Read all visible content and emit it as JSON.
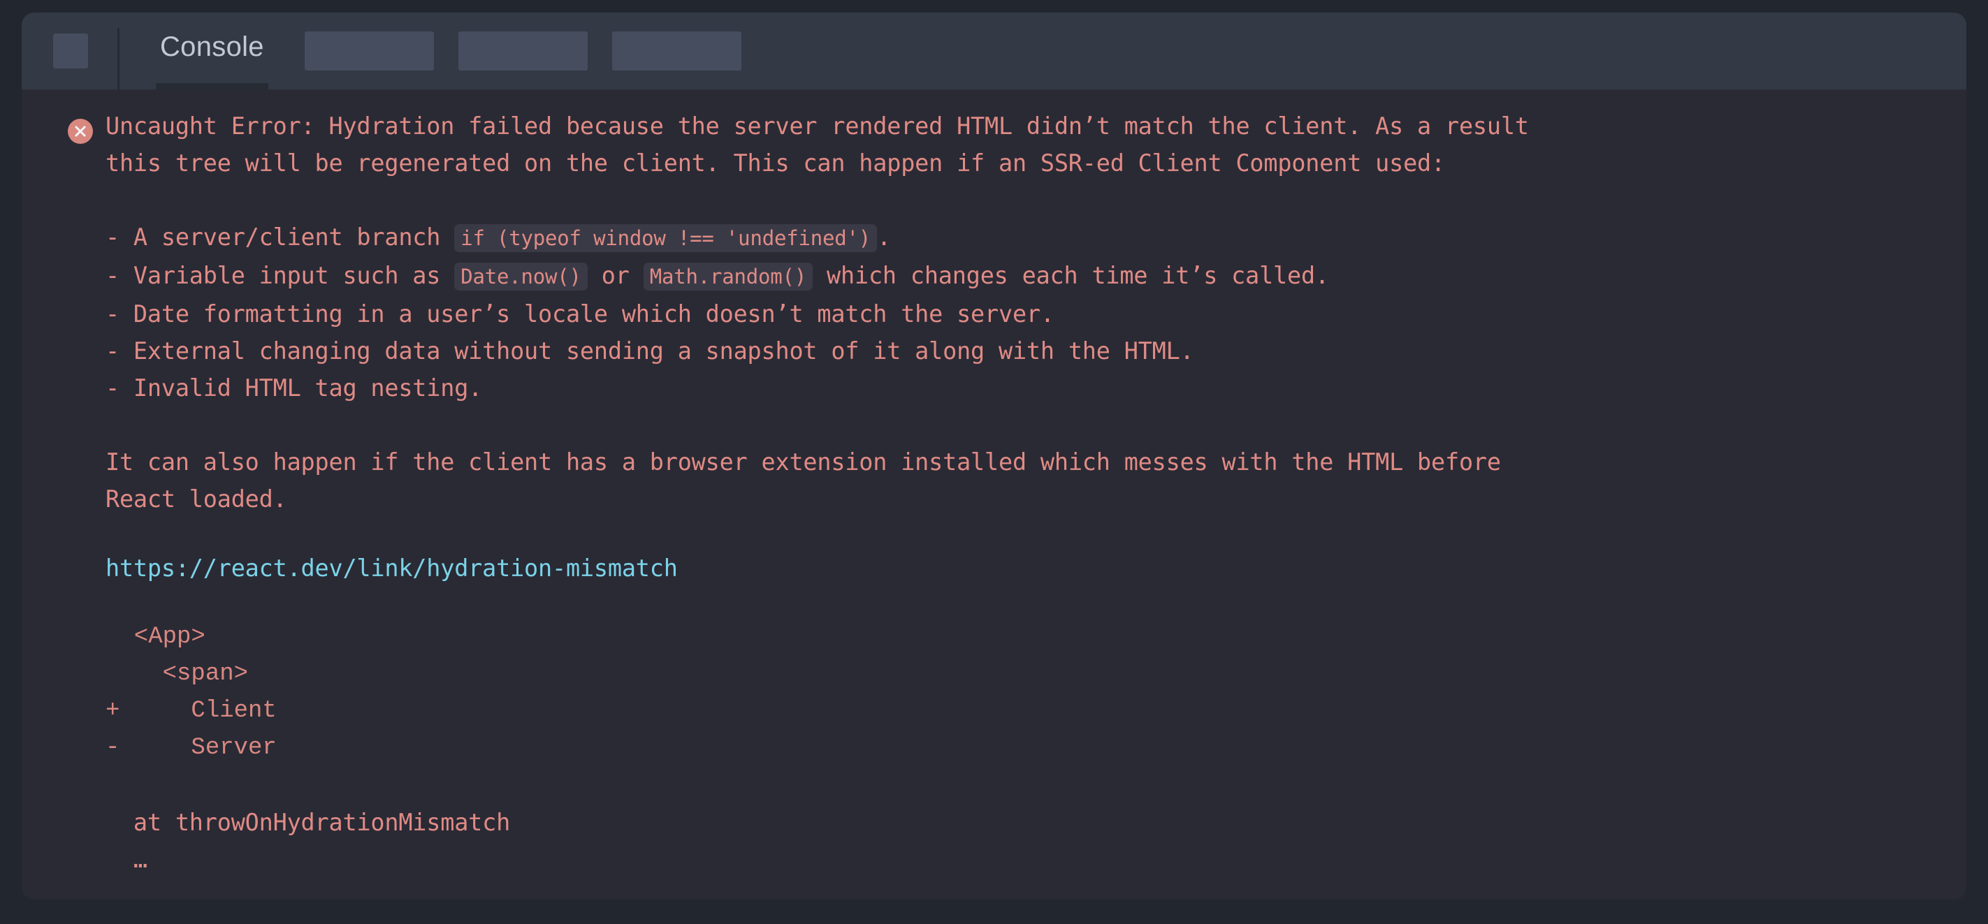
{
  "window": {
    "background_color": "#22262e",
    "panel_background": "#2a2a35",
    "header_background": "#333945"
  },
  "header": {
    "app_icon_name": "square-placeholder-icon",
    "tabs": [
      {
        "label": "Console",
        "active": true
      },
      {
        "label": "",
        "active": false
      },
      {
        "label": "",
        "active": false
      },
      {
        "label": "",
        "active": false
      }
    ],
    "placeholder_count": 3
  },
  "console": {
    "entry": {
      "level": "error",
      "icon": "error-circle-x-icon",
      "icon_color": "#d98880",
      "text_color": "#e08b85",
      "link_color": "#7bd3e8",
      "paragraph_1": "Uncaught Error: Hydration failed because the server rendered HTML didn’t match the client. As a result\nthis tree will be regenerated on the client. This can happen if an SSR-ed Client Component used:",
      "bullets": [
        {
          "prefix": "- A server/client branch ",
          "code": "if (typeof window !== 'undefined')",
          "suffix": "."
        },
        {
          "prefix": "- Variable input such as ",
          "code": "Date.now()",
          "middle": " or ",
          "code2": "Math.random()",
          "suffix": " which changes each time it’s called."
        },
        {
          "prefix": "- Date formatting in a user’s locale which doesn’t match the server.",
          "code": "",
          "suffix": ""
        },
        {
          "prefix": "- External changing data without sending a snapshot of it along with the HTML.",
          "code": "",
          "suffix": ""
        },
        {
          "prefix": "- Invalid HTML tag nesting.",
          "code": "",
          "suffix": ""
        }
      ],
      "paragraph_2": "It can also happen if the client has a browser extension installed which messes with the HTML before\nReact loaded.",
      "link_text": "https://react.dev/link/hydration-mismatch",
      "diff": "  <App>\n    <span>\n+     Client\n-     Server",
      "stack": "  at throwOnHydrationMismatch\n  …"
    }
  }
}
